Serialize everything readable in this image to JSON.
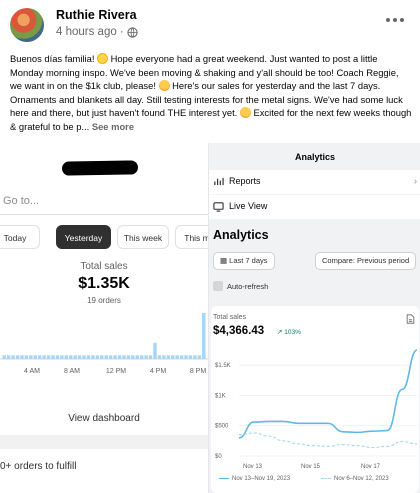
{
  "post": {
    "author": "Ruthie Rivera",
    "time": "4 hours ago",
    "text_1": "Buenos días familia! ",
    "text_2": " Hope everyone had a great weekend. Just wanted to post a little Monday morning inspo. We've been moving & shaking and y'all should be too! Coach Reggie, we want in on the $1k club, please! ",
    "text_3": " Here's our sales for yesterday and the last 7 days. Ornaments and blankets all day. Still testing interests for the metal signs. We've had some luck here and there, but just haven't found THE interest yet. ",
    "text_4": " Excited for the next few weeks though & grateful to be p... ",
    "see_more": "See more"
  },
  "left_screenshot": {
    "search_placeholder": "Go to...",
    "tabs": [
      "Today",
      "Yesterday",
      "This week",
      "This m"
    ],
    "active_tab": "Yesterday",
    "metric_label": "Total sales",
    "metric_value": "$1.35K",
    "metric_sub": "19 orders",
    "view_dashboard": "View dashboard",
    "orders_to_fulfill": "0+ orders to fulfill",
    "accent_color": "#a5d6f7"
  },
  "right_screenshot": {
    "header_title": "Analytics",
    "reports_label": "Reports",
    "live_view_label": "Live View",
    "heading": "Analytics",
    "date_button": "Last 7 days",
    "compare_button": "Compare: Previous period",
    "auto_refresh": "Auto-refresh",
    "card_label": "Total sales",
    "card_value": "$4,366.43",
    "card_change": "↗ 103%",
    "line_color": "#5fb8e6"
  },
  "chart_data": [
    {
      "type": "bar",
      "categories": [
        "4 AM",
        "8 AM",
        "12 PM",
        "4 PM",
        "8 PM"
      ],
      "bar_values": [
        0.08,
        0.08,
        0.08,
        0.08,
        0.08,
        0.08,
        0.08,
        0.08,
        0.08,
        0.08,
        0.08,
        0.08,
        0.08,
        0.08,
        0.08,
        0.08,
        0.08,
        0.08,
        0.08,
        0.08,
        0.08,
        0.08,
        0.08,
        0.08,
        0.08,
        0.08,
        0.08,
        0.08,
        0.08,
        0.08,
        0.08,
        0.08,
        0.08,
        0.08,
        0.35,
        0.08,
        0.08,
        0.08,
        0.08,
        0.08,
        0.08,
        0.08,
        0.08,
        0.08,
        0.08,
        1.0
      ],
      "title": "",
      "xlabel": "",
      "ylabel": ""
    },
    {
      "type": "line",
      "x_ticks": [
        "Nov 13",
        "Nov 15",
        "Nov 17"
      ],
      "y_ticks": [
        "$0",
        "$500",
        "$1K",
        "$1.5K"
      ],
      "ylim": [
        0,
        1750
      ],
      "series": [
        {
          "name": "Nov 13–Nov 19, 2023",
          "values": [
            300,
            560,
            570,
            570,
            540,
            540,
            540,
            400,
            390,
            410,
            420,
            1100,
            1750
          ]
        },
        {
          "name": "Nov 6–Nov 12, 2023",
          "values": [
            350,
            380,
            330,
            250,
            200,
            170,
            160,
            190,
            170,
            140,
            160,
            240,
            200
          ]
        }
      ]
    }
  ]
}
